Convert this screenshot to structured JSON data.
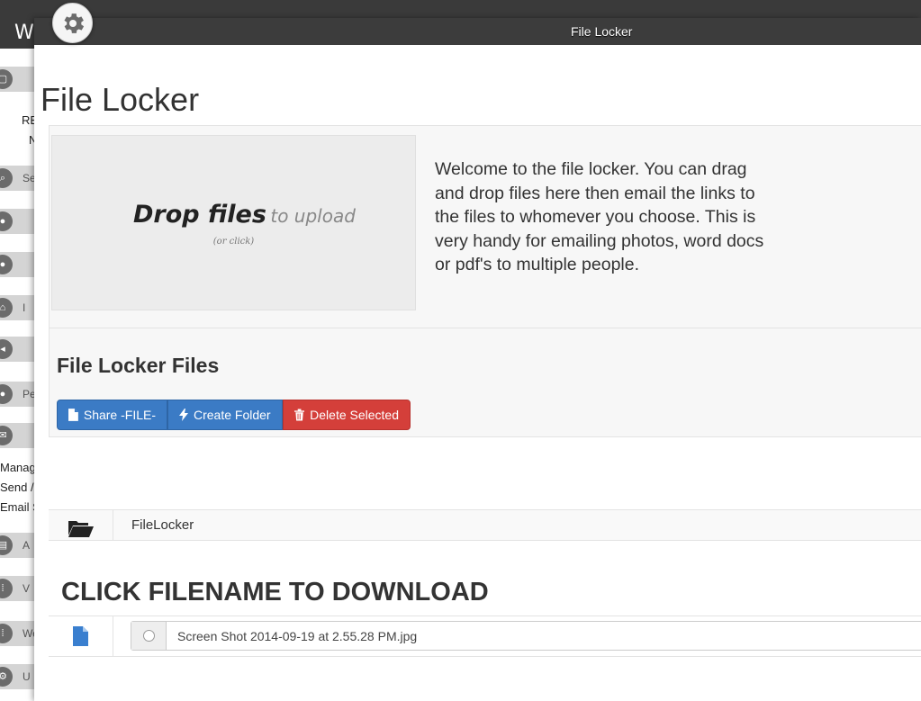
{
  "background_app": {
    "logo_text": "W",
    "nav_items": [
      {
        "icon": "window-icon",
        "label": ""
      },
      {
        "icon": "search-icon",
        "label": "Se"
      },
      {
        "icon": "users-icon",
        "label": ""
      },
      {
        "icon": "users-icon",
        "label": ""
      },
      {
        "icon": "home-icon",
        "label": "I"
      },
      {
        "icon": "megaphone-icon",
        "label": ""
      },
      {
        "icon": "users-icon",
        "label": "Pe"
      },
      {
        "icon": "mail-icon",
        "label": ""
      },
      {
        "icon": "folder-icon",
        "label": "A"
      },
      {
        "icon": "grid-icon",
        "label": "V"
      },
      {
        "icon": "grid-icon",
        "label": "We"
      },
      {
        "icon": "gear-icon",
        "label": "U"
      }
    ],
    "text_fragments": [
      "RE",
      "N",
      "Manag",
      "Send /",
      "Email S"
    ]
  },
  "modal": {
    "title": "File Locker"
  },
  "page": {
    "title": "File Locker",
    "dropzone": {
      "main_strong": "Drop files",
      "main_light": "to upload",
      "sub": "(or click)"
    },
    "welcome_text": "Welcome to the file locker. You can drag and drop files here then email the links to the files to whomever you choose. This is very handy for emailing photos, word docs or pdf's to multiple people.",
    "files_section": {
      "title": "File Locker Files",
      "buttons": {
        "share": "Share -FILE-",
        "create_folder": "Create Folder",
        "delete_selected": "Delete Selected"
      }
    },
    "folder": {
      "name": "FileLocker"
    },
    "download_heading": "CLICK FILENAME TO DOWNLOAD",
    "files": [
      {
        "name": "Screen Shot 2014-09-19 at 2.55.28 PM.jpg"
      }
    ]
  },
  "colors": {
    "primary": "#3b7bc5",
    "danger": "#d43f3a",
    "header": "#3c3c3c",
    "file_icon": "#3a7fcf"
  }
}
